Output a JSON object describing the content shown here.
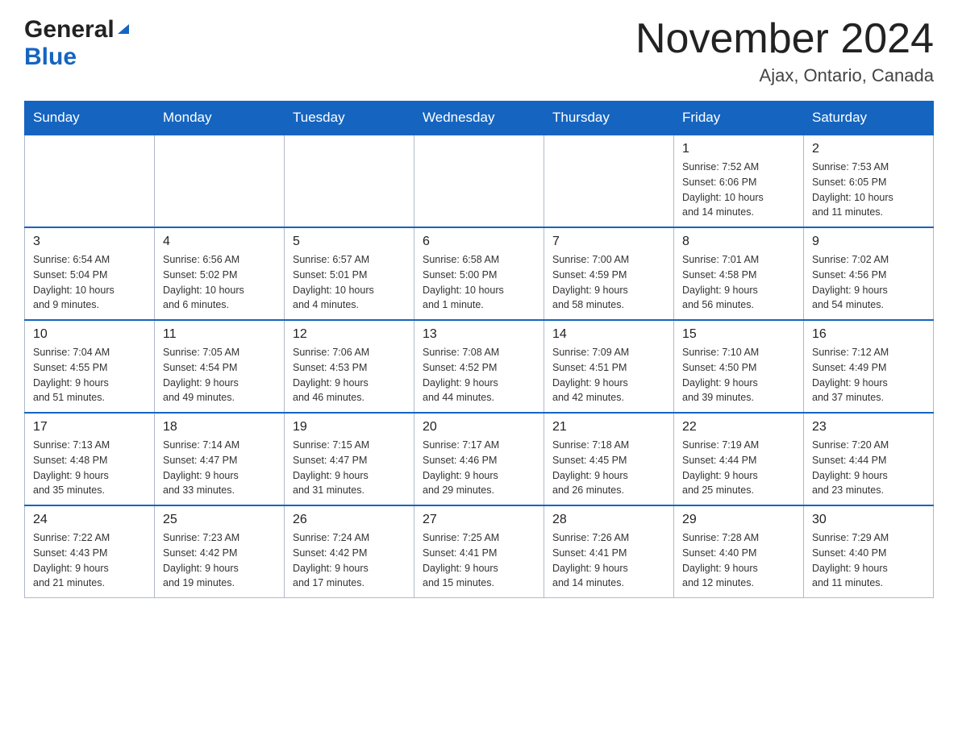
{
  "header": {
    "logo_general": "General",
    "logo_blue": "Blue",
    "title": "November 2024",
    "location": "Ajax, Ontario, Canada"
  },
  "weekdays": [
    "Sunday",
    "Monday",
    "Tuesday",
    "Wednesday",
    "Thursday",
    "Friday",
    "Saturday"
  ],
  "weeks": [
    [
      {
        "day": "",
        "info": ""
      },
      {
        "day": "",
        "info": ""
      },
      {
        "day": "",
        "info": ""
      },
      {
        "day": "",
        "info": ""
      },
      {
        "day": "",
        "info": ""
      },
      {
        "day": "1",
        "info": "Sunrise: 7:52 AM\nSunset: 6:06 PM\nDaylight: 10 hours\nand 14 minutes."
      },
      {
        "day": "2",
        "info": "Sunrise: 7:53 AM\nSunset: 6:05 PM\nDaylight: 10 hours\nand 11 minutes."
      }
    ],
    [
      {
        "day": "3",
        "info": "Sunrise: 6:54 AM\nSunset: 5:04 PM\nDaylight: 10 hours\nand 9 minutes."
      },
      {
        "day": "4",
        "info": "Sunrise: 6:56 AM\nSunset: 5:02 PM\nDaylight: 10 hours\nand 6 minutes."
      },
      {
        "day": "5",
        "info": "Sunrise: 6:57 AM\nSunset: 5:01 PM\nDaylight: 10 hours\nand 4 minutes."
      },
      {
        "day": "6",
        "info": "Sunrise: 6:58 AM\nSunset: 5:00 PM\nDaylight: 10 hours\nand 1 minute."
      },
      {
        "day": "7",
        "info": "Sunrise: 7:00 AM\nSunset: 4:59 PM\nDaylight: 9 hours\nand 58 minutes."
      },
      {
        "day": "8",
        "info": "Sunrise: 7:01 AM\nSunset: 4:58 PM\nDaylight: 9 hours\nand 56 minutes."
      },
      {
        "day": "9",
        "info": "Sunrise: 7:02 AM\nSunset: 4:56 PM\nDaylight: 9 hours\nand 54 minutes."
      }
    ],
    [
      {
        "day": "10",
        "info": "Sunrise: 7:04 AM\nSunset: 4:55 PM\nDaylight: 9 hours\nand 51 minutes."
      },
      {
        "day": "11",
        "info": "Sunrise: 7:05 AM\nSunset: 4:54 PM\nDaylight: 9 hours\nand 49 minutes."
      },
      {
        "day": "12",
        "info": "Sunrise: 7:06 AM\nSunset: 4:53 PM\nDaylight: 9 hours\nand 46 minutes."
      },
      {
        "day": "13",
        "info": "Sunrise: 7:08 AM\nSunset: 4:52 PM\nDaylight: 9 hours\nand 44 minutes."
      },
      {
        "day": "14",
        "info": "Sunrise: 7:09 AM\nSunset: 4:51 PM\nDaylight: 9 hours\nand 42 minutes."
      },
      {
        "day": "15",
        "info": "Sunrise: 7:10 AM\nSunset: 4:50 PM\nDaylight: 9 hours\nand 39 minutes."
      },
      {
        "day": "16",
        "info": "Sunrise: 7:12 AM\nSunset: 4:49 PM\nDaylight: 9 hours\nand 37 minutes."
      }
    ],
    [
      {
        "day": "17",
        "info": "Sunrise: 7:13 AM\nSunset: 4:48 PM\nDaylight: 9 hours\nand 35 minutes."
      },
      {
        "day": "18",
        "info": "Sunrise: 7:14 AM\nSunset: 4:47 PM\nDaylight: 9 hours\nand 33 minutes."
      },
      {
        "day": "19",
        "info": "Sunrise: 7:15 AM\nSunset: 4:47 PM\nDaylight: 9 hours\nand 31 minutes."
      },
      {
        "day": "20",
        "info": "Sunrise: 7:17 AM\nSunset: 4:46 PM\nDaylight: 9 hours\nand 29 minutes."
      },
      {
        "day": "21",
        "info": "Sunrise: 7:18 AM\nSunset: 4:45 PM\nDaylight: 9 hours\nand 26 minutes."
      },
      {
        "day": "22",
        "info": "Sunrise: 7:19 AM\nSunset: 4:44 PM\nDaylight: 9 hours\nand 25 minutes."
      },
      {
        "day": "23",
        "info": "Sunrise: 7:20 AM\nSunset: 4:44 PM\nDaylight: 9 hours\nand 23 minutes."
      }
    ],
    [
      {
        "day": "24",
        "info": "Sunrise: 7:22 AM\nSunset: 4:43 PM\nDaylight: 9 hours\nand 21 minutes."
      },
      {
        "day": "25",
        "info": "Sunrise: 7:23 AM\nSunset: 4:42 PM\nDaylight: 9 hours\nand 19 minutes."
      },
      {
        "day": "26",
        "info": "Sunrise: 7:24 AM\nSunset: 4:42 PM\nDaylight: 9 hours\nand 17 minutes."
      },
      {
        "day": "27",
        "info": "Sunrise: 7:25 AM\nSunset: 4:41 PM\nDaylight: 9 hours\nand 15 minutes."
      },
      {
        "day": "28",
        "info": "Sunrise: 7:26 AM\nSunset: 4:41 PM\nDaylight: 9 hours\nand 14 minutes."
      },
      {
        "day": "29",
        "info": "Sunrise: 7:28 AM\nSunset: 4:40 PM\nDaylight: 9 hours\nand 12 minutes."
      },
      {
        "day": "30",
        "info": "Sunrise: 7:29 AM\nSunset: 4:40 PM\nDaylight: 9 hours\nand 11 minutes."
      }
    ]
  ]
}
